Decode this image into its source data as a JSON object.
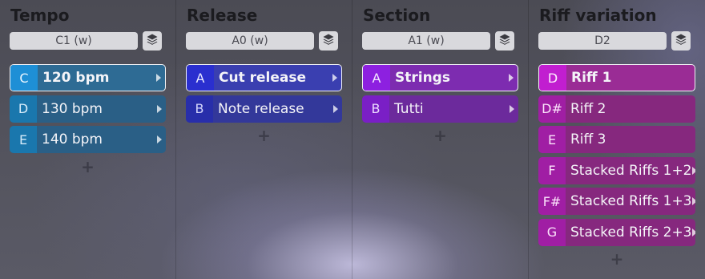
{
  "columns": [
    {
      "title": "Tempo",
      "selector": "C1 (w)",
      "items": [
        {
          "key": "C",
          "label": "120 bpm",
          "selected": true
        },
        {
          "key": "D",
          "label": "130 bpm",
          "selected": false
        },
        {
          "key": "E",
          "label": "140 bpm",
          "selected": false
        }
      ],
      "add_label": "+"
    },
    {
      "title": "Release",
      "selector": "A0 (w)",
      "items": [
        {
          "key": "A",
          "label": "Cut release",
          "selected": true
        },
        {
          "key": "B",
          "label": "Note release",
          "selected": false
        }
      ],
      "add_label": "+"
    },
    {
      "title": "Section",
      "selector": "A1 (w)",
      "items": [
        {
          "key": "A",
          "label": "Strings",
          "selected": true
        },
        {
          "key": "B",
          "label": "Tutti",
          "selected": false
        }
      ],
      "add_label": "+"
    },
    {
      "title": "Riff variation",
      "selector": "D2",
      "items": [
        {
          "key": "D",
          "label": "Riff 1",
          "selected": true
        },
        {
          "key": "D#",
          "label": "Riff 2",
          "selected": false
        },
        {
          "key": "E",
          "label": "Riff 3",
          "selected": false
        },
        {
          "key": "F",
          "label": "Stacked Riffs 1+2",
          "selected": false
        },
        {
          "key": "F#",
          "label": "Stacked Riffs 1+3",
          "selected": false
        },
        {
          "key": "G",
          "label": "Stacked Riffs 2+3",
          "selected": false
        }
      ],
      "add_label": "+"
    }
  ],
  "icons": {
    "layers": "layers-icon",
    "submenu": "chevron-right-icon",
    "add": "plus-icon"
  },
  "colors": {
    "tempo_accent": "#1e8fd6",
    "release_accent": "#2a2fcf",
    "section_accent": "#8d20e0",
    "riff_accent": "#c11ed0"
  }
}
